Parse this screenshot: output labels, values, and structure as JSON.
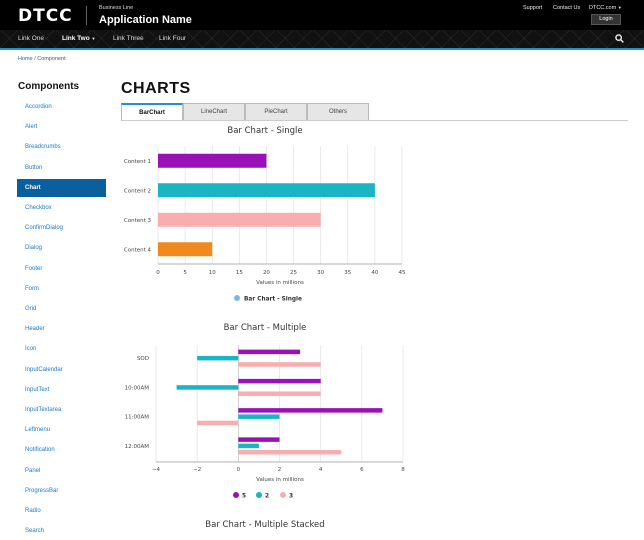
{
  "header": {
    "logo": "DTCC",
    "business_line": "Business Line",
    "app_name": "Application Name",
    "support": "Support",
    "contact": "Contact Us",
    "site": "DTCC.com",
    "login": "Login"
  },
  "nav": {
    "links": [
      "Link One",
      "Link Two",
      "Link Three",
      "Link Four"
    ],
    "active_index": 1
  },
  "breadcrumb": {
    "home": "Home",
    "separator": "/",
    "current": "Component"
  },
  "sidebar": {
    "title": "Components",
    "items": [
      "Accordion",
      "Alert",
      "Breadcrumbs",
      "Button",
      "Chart",
      "Checkbox",
      "ConfirmDialog",
      "Dialog",
      "Footer",
      "Form",
      "Grid",
      "Header",
      "Icon",
      "InputCalendar",
      "InputText",
      "InputTextarea",
      "Leftmenu",
      "Notification",
      "Panel",
      "ProgressBar",
      "Radio",
      "Search"
    ],
    "active_index": 4
  },
  "main": {
    "title": "CHARTS",
    "tabs": [
      "BarChart",
      "LineChart",
      "PieChart",
      "Others"
    ],
    "active_tab": 0
  },
  "chart_data": [
    {
      "type": "bar",
      "orientation": "horizontal",
      "title": "Bar Chart - Single",
      "categories": [
        "Content 1",
        "Content 2",
        "Content 3",
        "Content 4"
      ],
      "values": [
        20,
        40,
        30,
        10
      ],
      "colors": [
        "#9b11b8",
        "#19b5c4",
        "#f8aeae",
        "#f08a1c"
      ],
      "xlabel": "Values in millions",
      "xlim": [
        0,
        45
      ],
      "xticks": [
        0,
        5,
        10,
        15,
        20,
        25,
        30,
        35,
        40,
        45
      ],
      "grid": true,
      "legend": {
        "label": "Bar Chart - Single",
        "color": "#7db7e8",
        "position": "bottom"
      }
    },
    {
      "type": "bar",
      "orientation": "horizontal",
      "title": "Bar Chart - Multiple",
      "categories": [
        "SOD",
        "10:00AM",
        "11:00AM",
        "12:00AM"
      ],
      "series": [
        {
          "name": "5",
          "color": "#9b11b8",
          "values": [
            3,
            4,
            7,
            2
          ]
        },
        {
          "name": "2",
          "color": "#19b5c4",
          "values": [
            -2,
            -3,
            2,
            1
          ]
        },
        {
          "name": "3",
          "color": "#f8aeae",
          "values": [
            4,
            4,
            -2,
            5
          ]
        }
      ],
      "xlabel": "Values in millions",
      "xlim": [
        -4,
        8
      ],
      "xticks": [
        -4,
        -2,
        0,
        2,
        4,
        6,
        8
      ],
      "grid": true,
      "legend_position": "bottom"
    },
    {
      "type": "bar",
      "orientation": "horizontal",
      "title": "Bar Chart - Multiple Stacked"
    }
  ]
}
